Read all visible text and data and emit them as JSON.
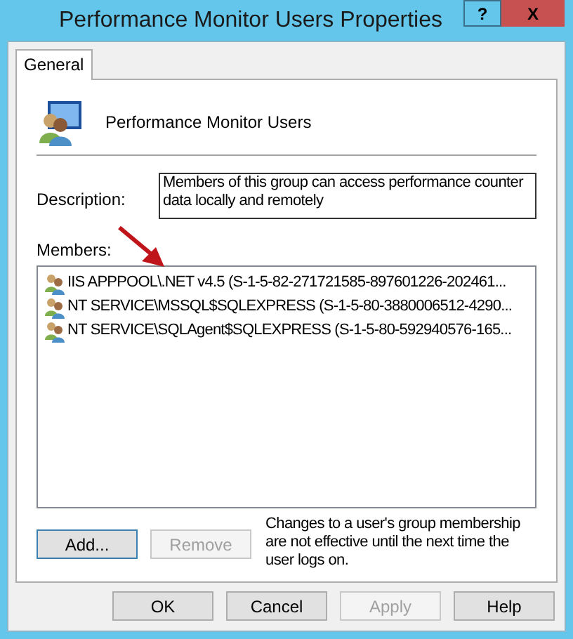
{
  "window": {
    "title": "Performance Monitor Users Properties",
    "help_glyph": "?",
    "close_glyph": "X"
  },
  "tabs": [
    {
      "label": "General",
      "selected": true
    }
  ],
  "group": {
    "name": "Performance Monitor Users"
  },
  "description": {
    "label": "Description:",
    "value": "Members of this group can access performance counter data locally and remotely"
  },
  "members": {
    "label": "Members:",
    "items": [
      {
        "name": "IIS APPPOOL\\.NET v4.5 (S-1-5-82-271721585-897601226-202461...",
        "selected": false
      },
      {
        "name": "NT SERVICE\\MSSQL$SQLEXPRESS (S-1-5-80-3880006512-4290...",
        "selected": false
      },
      {
        "name": "NT SERVICE\\SQLAgent$SQLEXPRESS (S-1-5-80-592940576-165...",
        "selected": false
      }
    ]
  },
  "member_buttons": [
    {
      "label": "Add...",
      "disabled": false,
      "focused": true
    },
    {
      "label": "Remove",
      "disabled": true,
      "focused": false
    }
  ],
  "note": "Changes to a user's group membership are not effective until the next time the user logs on.",
  "dialog_buttons": [
    {
      "label": "OK",
      "disabled": false
    },
    {
      "label": "Cancel",
      "disabled": false
    },
    {
      "label": "Apply",
      "disabled": true
    },
    {
      "label": "Help",
      "disabled": false
    }
  ]
}
